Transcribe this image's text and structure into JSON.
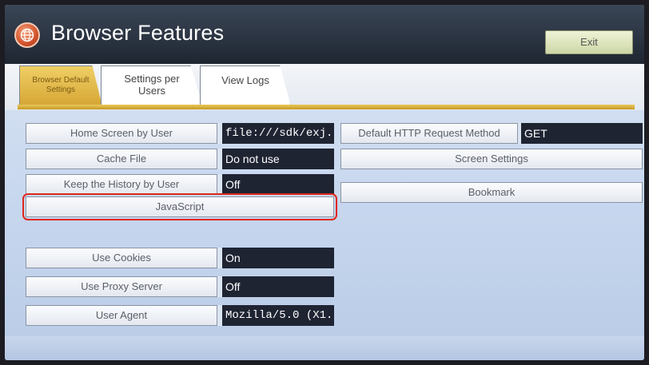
{
  "header": {
    "title": "Browser Features",
    "exit_label": "Exit",
    "icon": "globe-icon"
  },
  "tabs": [
    {
      "label_line1": "Browser Default",
      "label_line2": "Settings",
      "active": true
    },
    {
      "label_line1": "Settings per",
      "label_line2": "Users",
      "active": false
    },
    {
      "label_line1": "View Logs",
      "label_line2": "",
      "active": false
    }
  ],
  "left_settings": [
    {
      "label": "Home Screen by User",
      "value": "file:///sdk/exj."
    },
    {
      "label": "Cache File",
      "value": "Do not use"
    },
    {
      "label": "Keep the History by User",
      "value": "Off"
    },
    {
      "label": "JavaScript",
      "value": ""
    },
    {
      "label": "Use Cookies",
      "value": "On"
    },
    {
      "label": "Use Proxy Server",
      "value": "Off"
    },
    {
      "label": "User Agent",
      "value": "Mozilla/5.0 (X1."
    }
  ],
  "right_settings": [
    {
      "label": "Default HTTP Request Method",
      "value": "GET"
    },
    {
      "label": "Screen Settings",
      "value": ""
    },
    {
      "label": "Bookmark",
      "value": ""
    }
  ],
  "colors": {
    "title_bar": "#2a3342",
    "active_tab": "#e2b84a",
    "value_background": "#1f2433",
    "highlight": "#e0261c"
  }
}
